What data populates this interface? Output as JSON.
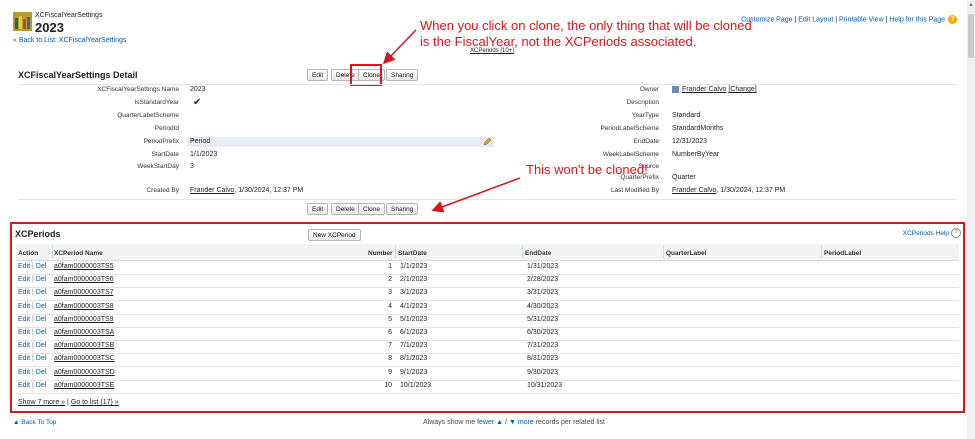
{
  "header": {
    "object_type": "XCFiscalYearSettings",
    "title": "2023",
    "back_link": "« Back to List: XCFiscalYearSettings",
    "related_link": "XCPeriods [10+]"
  },
  "top_links": {
    "customize": "Customize Page",
    "edit_layout": "Edit Layout",
    "printable": "Printable View",
    "help": "Help for this Page",
    "sep": " | ",
    "help_icon": "?"
  },
  "detail": {
    "title": "XCFiscalYearSettings Detail",
    "buttons": {
      "edit": "Edit",
      "delete": "Delete",
      "clone": "Clone",
      "sharing": "Sharing"
    },
    "left_fields": [
      {
        "label": "XCFiscalYearSettings Name",
        "value": "2023"
      },
      {
        "label": "IsStandardYear",
        "value": "✔"
      },
      {
        "label": "QuarterLabelScheme",
        "value": ""
      },
      {
        "label": "PeriodId",
        "value": ""
      },
      {
        "label": "PeriodPrefix",
        "value": "Period"
      },
      {
        "label": "StartDate",
        "value": "1/1/2023"
      },
      {
        "label": "WeekStartDay",
        "value": "3"
      }
    ],
    "right_fields": [
      {
        "label": "Owner",
        "value": "Frander Calvo",
        "extra": "[Change]"
      },
      {
        "label": "Description",
        "value": ""
      },
      {
        "label": "YearType",
        "value": "Standard"
      },
      {
        "label": "PeriodLabelScheme",
        "value": "StandardMonths"
      },
      {
        "label": "EndDate",
        "value": "12/31/2023"
      },
      {
        "label": "WeekLabelScheme",
        "value": "NumberByYear"
      },
      {
        "label": "Source",
        "value": ""
      },
      {
        "label": "QuarterPrefix",
        "value": "Quarter"
      }
    ],
    "created_by": {
      "label": "Created By",
      "name": "Frander Calvo",
      "date": ", 1/30/2024, 12:37 PM"
    },
    "modified_by": {
      "label": "Last Modified By",
      "name": "Frander Calvo",
      "date": ", 1/30/2024, 12:37 PM"
    }
  },
  "annotations": {
    "clone_note_1": "When you click on clone, the only thing that will be cloned",
    "clone_note_2": "is the FiscalYear, not the XCPeriods associated.",
    "periods_note": "This won't be cloned!"
  },
  "periods": {
    "title": "XCPeriods",
    "new_button": "New XCPeriod",
    "help": "XCPeriods Help",
    "help_icon": "?",
    "columns": [
      "Action",
      "XCPeriod Name",
      "Number",
      "StartDate",
      "EndDate",
      "QuarterLabel",
      "PeriodLabel"
    ],
    "action_edit": "Edit",
    "action_sep": " | ",
    "action_del": "Del",
    "rows": [
      {
        "name": "a0fam0000003TS5",
        "number": "1",
        "start": "1/1/2023",
        "end": "1/31/2023"
      },
      {
        "name": "a0fam0000003TS6",
        "number": "2",
        "start": "2/1/2023",
        "end": "2/28/2023"
      },
      {
        "name": "a0fam0000003TS7",
        "number": "3",
        "start": "3/1/2023",
        "end": "3/31/2023"
      },
      {
        "name": "a0fam0000003TS8",
        "number": "4",
        "start": "4/1/2023",
        "end": "4/30/2023"
      },
      {
        "name": "a0fam0000003TS9",
        "number": "5",
        "start": "5/1/2023",
        "end": "5/31/2023"
      },
      {
        "name": "a0fam0000003TSA",
        "number": "6",
        "start": "6/1/2023",
        "end": "6/30/2023"
      },
      {
        "name": "a0fam0000003TSB",
        "number": "7",
        "start": "7/1/2023",
        "end": "7/31/2023"
      },
      {
        "name": "a0fam0000003TSC",
        "number": "8",
        "start": "8/1/2023",
        "end": "8/31/2023"
      },
      {
        "name": "a0fam0000003TSD",
        "number": "9",
        "start": "9/1/2023",
        "end": "9/30/2023"
      },
      {
        "name": "a0fam0000003TSE",
        "number": "10",
        "start": "10/1/2023",
        "end": "10/31/2023"
      }
    ],
    "show_more": "Show 7 more »",
    "sep": " | ",
    "go_to_list": "Go to list (17) »"
  },
  "footer": {
    "back_to_top": "Back To Top",
    "always_show": "Always show me ",
    "fewer": "fewer",
    "sep": " / ",
    "more": "more",
    "suffix": " records per related list"
  },
  "colors": {
    "annotation_red": "#d9161d",
    "link_blue": "#015ba7",
    "help_orange": "#f6a800"
  },
  "icons": [
    "calendar-icon",
    "pencil-icon",
    "user-icon",
    "help-icon",
    "arrow-up-icon",
    "arrow-down-icon"
  ]
}
